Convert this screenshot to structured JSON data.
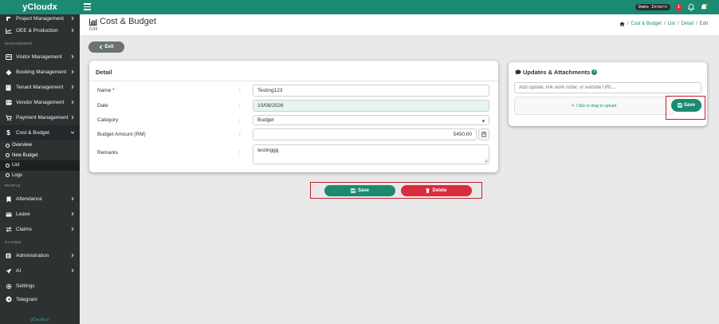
{
  "app": {
    "brand": "yCloudx",
    "user_label": "Demo Intern",
    "alert_count": "1"
  },
  "sidebar": {
    "items_top": [
      {
        "label": "Project Management",
        "icon": "project-icon"
      },
      {
        "label": "OEE & Production",
        "icon": "chart-icon"
      }
    ],
    "section_management": "MANAGEMENT",
    "items_mgmt": [
      {
        "label": "Visitor Management",
        "icon": "visitor-icon"
      },
      {
        "label": "Booking Management",
        "icon": "booking-icon"
      },
      {
        "label": "Tenant Management",
        "icon": "tenant-icon"
      },
      {
        "label": "Vendor Management",
        "icon": "vendor-icon"
      },
      {
        "label": "Payment Management",
        "icon": "cart-icon"
      },
      {
        "label": "Cost & Budget",
        "icon": "dollar-icon"
      }
    ],
    "sub_items": [
      "Overview",
      "New Budget",
      "List",
      "Logs"
    ],
    "section_people": "PEOPLE",
    "items_people": [
      {
        "label": "Attendance",
        "icon": "bookmark-icon"
      },
      {
        "label": "Leave",
        "icon": "leave-icon"
      },
      {
        "label": "Claims",
        "icon": "exchange-icon"
      }
    ],
    "section_system": "SYSTEM",
    "items_system": [
      {
        "label": "Administration",
        "icon": "admin-icon"
      },
      {
        "label": "AI",
        "icon": "paper-plane-icon"
      },
      {
        "label": "Settings",
        "icon": "gear-icon"
      },
      {
        "label": "Telegram",
        "icon": "telegram-icon"
      }
    ],
    "footer": "yCloudx.io"
  },
  "header": {
    "title": "Cost & Budget",
    "subtitle": "Edit",
    "breadcrumb": [
      "Cost & Budget",
      "List",
      "Detail",
      "Edit"
    ]
  },
  "exit_label": "Exit",
  "detail": {
    "title": "Detail",
    "fields": {
      "name_label": "Name *",
      "name_value": "Testing123",
      "date_label": "Date",
      "date_value": "10/08/2026",
      "category_label": "Category",
      "category_value": "Budget",
      "amount_label": "Budget Amount (RM)",
      "amount_value": "5450.00",
      "remarks_label": "Remarks",
      "remarks_value": "testinggg"
    },
    "colon": ":"
  },
  "updates": {
    "title": "Updates & Attachments",
    "input_placeholder": "Add update, link work order, or website URL...",
    "dropzone": "Click or drag to upload",
    "save_label": "Save"
  },
  "actions": {
    "save_label": "Save",
    "delete_label": "Delete"
  },
  "colors": {
    "primary": "#1c8a72",
    "danger": "#d92d3d",
    "sidebar": "#2d3132",
    "highlight_border": "#c0212f"
  }
}
